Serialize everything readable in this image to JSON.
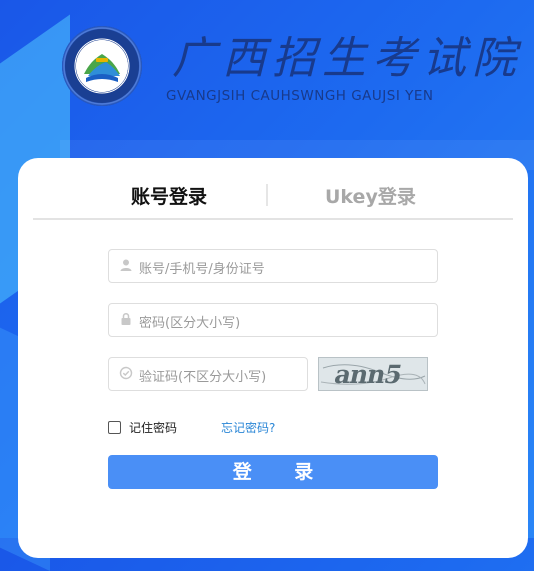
{
  "header": {
    "title": "广西招生考试院",
    "subtitle": "GVANGJSIH CAUHSWNGH GAUJSI YEN",
    "emblem_ring_text": "GVANGJSIH CAUHSWNGH GAUJSI YEN"
  },
  "tabs": [
    {
      "label": "账号登录",
      "active": true
    },
    {
      "label": "Ukey登录",
      "active": false
    }
  ],
  "form": {
    "username_placeholder": "账号/手机号/身份证号",
    "password_placeholder": "密码(区分大小写)",
    "captcha_placeholder": "验证码(不区分大小写)",
    "captcha_text": "ann5",
    "remember_label": "记住密码",
    "remember_checked": false,
    "forgot_label": "忘记密码?",
    "login_label": "登 录"
  },
  "colors": {
    "background": "#1d6af0",
    "brand_text": "#183a8c",
    "button": "#4a8ff6",
    "link": "#2a86d6"
  },
  "icons": [
    "user-icon",
    "lock-icon",
    "shield-check-icon"
  ]
}
